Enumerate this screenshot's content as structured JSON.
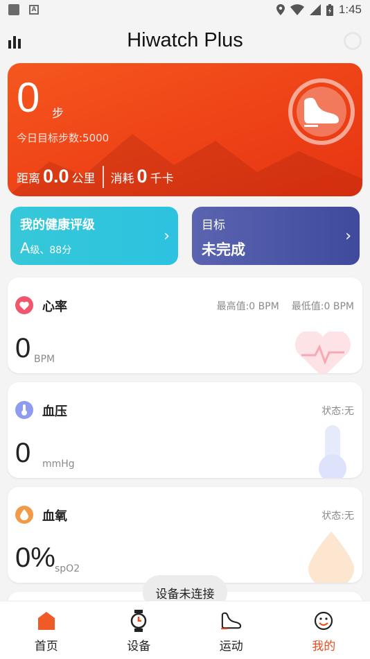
{
  "status_bar": {
    "time": "1:45"
  },
  "header": {
    "title": "Hiwatch Plus"
  },
  "hero": {
    "steps_value": "0",
    "steps_unit": "步",
    "goal_text": "今日目标步数:5000",
    "distance_label": "距离",
    "distance_value": "0.0",
    "distance_unit": "公里",
    "calories_label": "消耗",
    "calories_value": "0",
    "calories_unit": "千卡"
  },
  "health_card": {
    "title": "我的健康评级",
    "grade": "A",
    "grade_suffix": "级、88分"
  },
  "target_card": {
    "title": "目标",
    "status": "未完成"
  },
  "heart_rate": {
    "name": "心率",
    "max": "最高值:0 BPM",
    "min": "最低值:0 BPM",
    "value": "0",
    "unit": "BPM"
  },
  "blood_pressure": {
    "name": "血压",
    "status": "状态:无",
    "value": "0",
    "unit": "mmHg"
  },
  "blood_oxygen": {
    "name": "血氧",
    "status": "状态:无",
    "value": "0%",
    "unit": "spO2"
  },
  "toast": "设备未连接",
  "nav": {
    "home": "首页",
    "device": "设备",
    "sport": "运动",
    "mine": "我的",
    "active": "我的"
  },
  "colors": {
    "accent": "#ef4b1d",
    "teal": "#2cc2e0",
    "indigo": "#4a55a5"
  },
  "icons": [
    "stats-bars-icon",
    "sync-icon",
    "shoe-icon",
    "heart-icon",
    "thermometer-icon",
    "oxygen-icon",
    "home-icon",
    "watch-icon",
    "sport-shoe-icon",
    "smile-icon"
  ]
}
